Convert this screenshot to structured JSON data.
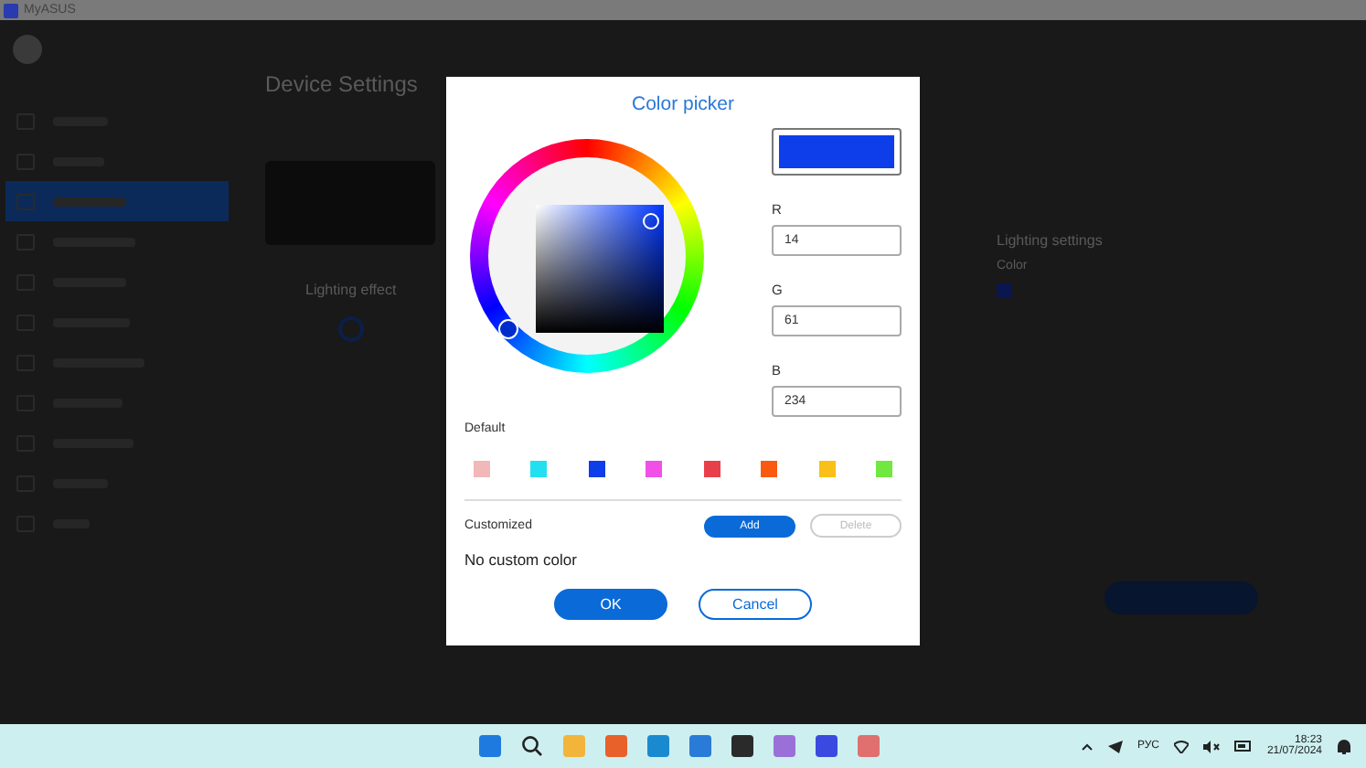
{
  "window": {
    "title": "MyASUS"
  },
  "sidebar": {
    "items": [
      {
        "selected": false
      },
      {
        "selected": false
      },
      {
        "selected": true
      },
      {
        "selected": false
      },
      {
        "selected": false
      },
      {
        "selected": false
      },
      {
        "selected": false
      },
      {
        "selected": false
      },
      {
        "selected": false
      },
      {
        "selected": false
      },
      {
        "selected": false
      }
    ]
  },
  "page": {
    "title": "Device Settings",
    "lighting_effect": "Lighting effect",
    "lighting_settings": "Lighting settings",
    "color_label": "Color"
  },
  "dialog": {
    "title": "Color picker",
    "channels": [
      {
        "label": "R",
        "value": "14"
      },
      {
        "label": "G",
        "value": "61"
      },
      {
        "label": "B",
        "value": "234"
      }
    ],
    "default_label": "Default",
    "swatches": [
      {
        "color": "#f0b8b8"
      },
      {
        "color": "#22e0f0"
      },
      {
        "color": "#0e3dea"
      },
      {
        "color": "#f050e8"
      },
      {
        "color": "#e8404a"
      },
      {
        "color": "#fa5a10"
      },
      {
        "color": "#f8c018"
      },
      {
        "color": "#70e840"
      }
    ],
    "customized_label": "Customized",
    "add": "Add",
    "delete": {
      "label": "Delete",
      "disabled": true
    },
    "empty_text": "No custom color",
    "ok": "OK",
    "cancel": "Cancel"
  },
  "taskbar": {
    "language": "РУС",
    "time": "18:23",
    "date": "21/07/2024"
  }
}
